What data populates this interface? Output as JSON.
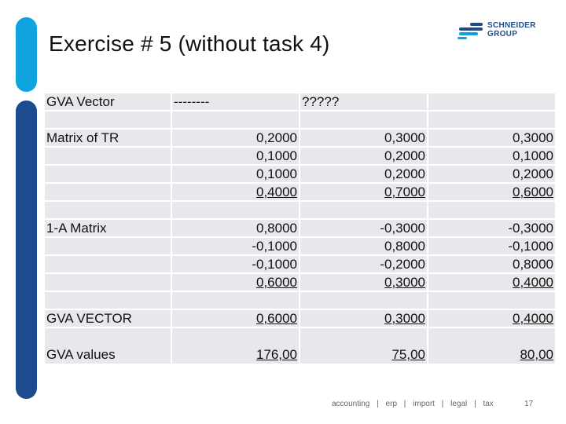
{
  "slide": {
    "title": "Exercise # 5 (without task 4)",
    "page_number": "17",
    "colors": {
      "accent_light": "#0ea3df",
      "accent_dark": "#1d4b8f",
      "cell_bg": "#e7e8ec"
    }
  },
  "logo": {
    "line1": "SCHNEIDER",
    "line2": "GROUP"
  },
  "footer": {
    "items": [
      "accounting",
      "erp",
      "import",
      "legal",
      "tax"
    ],
    "separator": "|"
  },
  "table": {
    "rows": [
      {
        "cells": [
          "GVA Vector",
          "--------",
          "?????",
          ""
        ],
        "underline": false
      },
      {
        "cells": [
          "",
          "",
          "",
          ""
        ],
        "underline": false
      },
      {
        "cells": [
          "Matrix of TR",
          "0,2000",
          "0,3000",
          "0,3000"
        ],
        "underline": false
      },
      {
        "cells": [
          "",
          "0,1000",
          "0,2000",
          "0,1000"
        ],
        "underline": false
      },
      {
        "cells": [
          "",
          "0,1000",
          "0,2000",
          "0,2000"
        ],
        "underline": false
      },
      {
        "cells": [
          "",
          "0,4000",
          "0,7000",
          "0,6000"
        ],
        "underline": true
      },
      {
        "cells": [
          "",
          "",
          "",
          ""
        ],
        "underline": false
      },
      {
        "cells": [
          "1-A Matrix",
          "0,8000",
          "-0,3000",
          "-0,3000"
        ],
        "underline": false
      },
      {
        "cells": [
          "",
          "-0,1000",
          "0,8000",
          "-0,1000"
        ],
        "underline": false
      },
      {
        "cells": [
          "",
          "-0,1000",
          "-0,2000",
          "0,8000"
        ],
        "underline": false
      },
      {
        "cells": [
          "",
          "0,6000",
          "0,3000",
          "0,4000"
        ],
        "underline": true
      },
      {
        "cells": [
          "",
          "",
          "",
          ""
        ],
        "underline": false
      },
      {
        "cells": [
          "GVA VECTOR",
          "0,6000",
          "0,3000",
          "0,4000"
        ],
        "underline": true
      },
      {
        "cells": [
          "GVA values",
          "176,00",
          "75,00",
          "80,00"
        ],
        "underline": true
      }
    ]
  }
}
